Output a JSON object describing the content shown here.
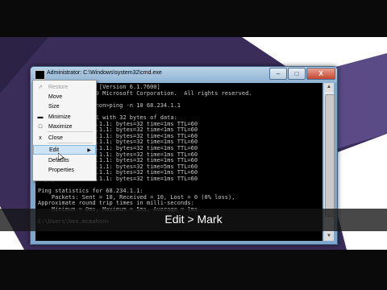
{
  "window": {
    "title": "Administrator: C:\\Windows\\system32\\cmd.exe",
    "buttons": {
      "minimize": "–",
      "maximize": "□",
      "close": "X"
    }
  },
  "console_text": "Microsoft Windows [Version 6.1.7600]\nCopyright (c) 2009 Microsoft Corporation.  All rights reserved.\n\nC:\\Users\\ben.mcmahon>ping -n 10 68.234.1.1\n\nPinging 68.234.1.1 with 32 bytes of data:\nReply from 68.234.1.1: bytes=32 time=1ms TTL=60\nReply from 68.234.1.1: bytes=32 time<1ms TTL=60\nReply from 68.234.1.1: bytes=32 time<1ms TTL=60\nReply from 68.234.1.1: bytes=32 time=1ms TTL=60\nReply from 68.234.1.1: bytes=32 time=1ms TTL=60\nReply from 68.234.1.1: bytes=32 time=1ms TTL=60\nReply from 68.234.1.1: bytes=32 time=1ms TTL=60\nReply from 68.234.1.1: bytes=32 time=5ms TTL=60\nReply from 68.234.1.1: bytes=32 time=1ms TTL=60\nReply from 68.234.1.1: bytes=32 time=1ms TTL=60\n\nPing statistics for 68.234.1.1:\n    Packets: Sent = 10, Received = 10, Lost = 0 (0% loss),\nApproximate round trip times in milli-seconds:\n    Minimum = 0ms, Maximum = 5ms, Average = 1ms\n\nC:\\Users\\ben.mcmahon>",
  "system_menu": [
    {
      "label": "Restore",
      "icon": "restore-icon",
      "glyph": "⇗",
      "disabled": true
    },
    {
      "label": "Move",
      "icon": "",
      "glyph": "",
      "disabled": false
    },
    {
      "label": "Size",
      "icon": "",
      "glyph": "",
      "disabled": false
    },
    {
      "label": "Minimize",
      "icon": "minimize-icon",
      "glyph": "▬",
      "disabled": false
    },
    {
      "label": "Maximize",
      "icon": "maximize-icon",
      "glyph": "□",
      "disabled": false
    },
    {
      "label": "Close",
      "icon": "close-icon",
      "glyph": "x",
      "disabled": false
    },
    {
      "label": "Edit",
      "icon": "",
      "glyph": "",
      "disabled": false,
      "submenu": true,
      "hovered": true
    },
    {
      "label": "Defaults",
      "icon": "",
      "glyph": "",
      "disabled": false
    },
    {
      "label": "Properties",
      "icon": "",
      "glyph": "",
      "disabled": false
    }
  ],
  "submenu_arrow": "▶",
  "caption": "Edit > Mark",
  "colors": {
    "console_bg": "#000000",
    "console_text": "#c8c8c8",
    "desktop_purple": "#3a2d5a",
    "menu_hover": "#cde4f7"
  }
}
